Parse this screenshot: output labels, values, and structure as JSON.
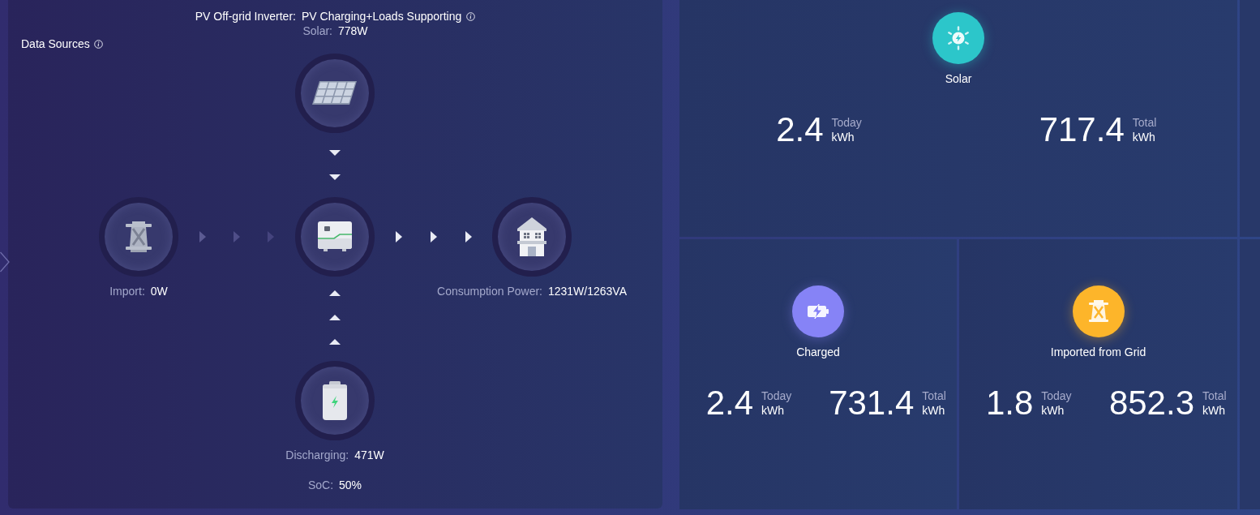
{
  "panel": {
    "title": "Data Sources",
    "inverter_label": "PV Off-grid Inverter:",
    "inverter_mode": "PV Charging+Loads Supporting"
  },
  "flow": {
    "solar": {
      "label": "Solar:",
      "value": "778W",
      "flowing": true
    },
    "grid": {
      "label": "Import:",
      "value": "0W",
      "flowing": false
    },
    "load": {
      "label": "Consumption Power:",
      "value": "1231W/1263VA",
      "flowing": true
    },
    "battery": {
      "label": "Discharging:",
      "value": "471W",
      "flowing": true
    },
    "soc": {
      "label": "SoC:",
      "value": "50%"
    }
  },
  "stats": [
    {
      "kind": "solar",
      "color": "#2cc6ca",
      "label": "Solar",
      "today": {
        "value": "2.4",
        "caption": "Today",
        "unit": "kWh"
      },
      "total": {
        "value": "717.4",
        "caption": "Total",
        "unit": "kWh"
      }
    },
    {
      "kind": "charged",
      "color": "#8683f6",
      "label": "Charged",
      "today": {
        "value": "2.4",
        "caption": "Today",
        "unit": "kWh"
      },
      "total": {
        "value": "731.4",
        "caption": "Total",
        "unit": "kWh"
      }
    },
    {
      "kind": "grid",
      "color": "#fdb52a",
      "label": "Imported from Grid",
      "today": {
        "value": "1.8",
        "caption": "Today",
        "unit": "kWh"
      },
      "total": {
        "value": "852.3",
        "caption": "Total",
        "unit": "kWh"
      }
    }
  ]
}
